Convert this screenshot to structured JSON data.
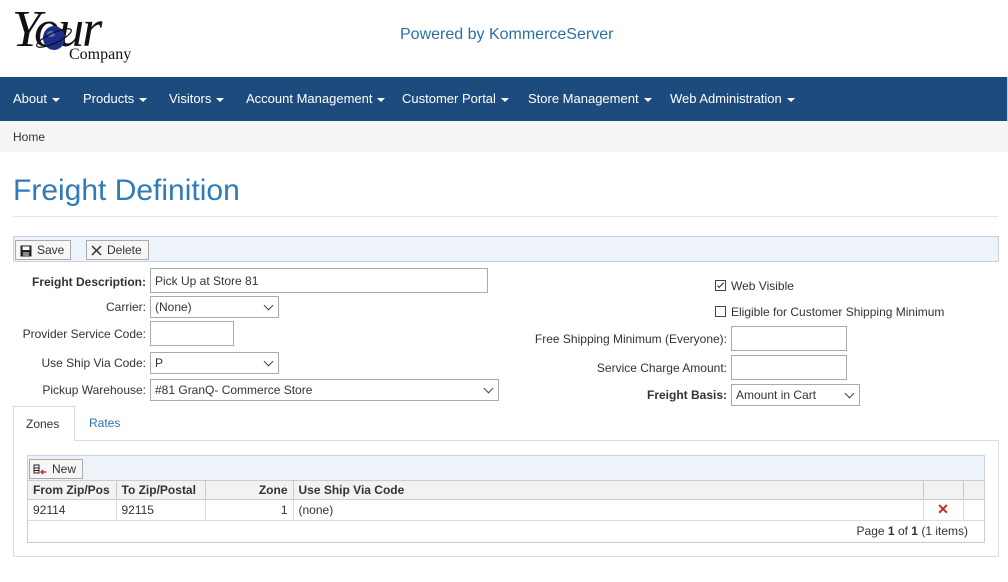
{
  "header": {
    "logo_your": "Your",
    "logo_company": "Company",
    "powered_by": "Powered by KommerceServer"
  },
  "nav": {
    "items": [
      {
        "label": "About"
      },
      {
        "label": "Products"
      },
      {
        "label": "Visitors"
      },
      {
        "label": "Account Management"
      },
      {
        "label": "Customer Portal"
      },
      {
        "label": "Store Management"
      },
      {
        "label": "Web Administration"
      }
    ]
  },
  "breadcrumb": {
    "home": "Home"
  },
  "page": {
    "title": "Freight Definition"
  },
  "toolbar": {
    "save": "Save",
    "delete": "Delete"
  },
  "form": {
    "freight_description_label": "Freight Description:",
    "freight_description_value": "Pick Up at Store 81",
    "carrier_label": "Carrier:",
    "carrier_value": "(None)",
    "provider_service_code_label": "Provider Service Code:",
    "provider_service_code_value": "",
    "use_ship_via_label": "Use Ship Via Code:",
    "use_ship_via_value": "P",
    "pickup_warehouse_label": "Pickup Warehouse:",
    "pickup_warehouse_value": "#81 GranQ- Commerce Store",
    "web_visible_label": "Web Visible",
    "web_visible_checked": true,
    "eligible_label": "Eligible for Customer Shipping Minimum",
    "eligible_checked": false,
    "free_shipping_label": "Free Shipping Minimum (Everyone):",
    "free_shipping_value": "",
    "service_charge_label": "Service Charge Amount:",
    "service_charge_value": "",
    "freight_basis_label": "Freight Basis:",
    "freight_basis_value": "Amount in Cart"
  },
  "tabs": [
    {
      "label": "Zones",
      "active": true
    },
    {
      "label": "Rates",
      "active": false
    }
  ],
  "zones_grid": {
    "new_label": "New",
    "columns": [
      "From Zip/Pos",
      "To Zip/Postal",
      "Zone",
      "Use Ship Via Code"
    ],
    "rows": [
      {
        "from": "92114",
        "to": "92115",
        "zone": "1",
        "ship_via": "(none)",
        "delete": "✕"
      }
    ],
    "pager": {
      "prefix": "Page",
      "page": "1",
      "of": "of",
      "total": "1",
      "items": "(1 items)"
    }
  }
}
